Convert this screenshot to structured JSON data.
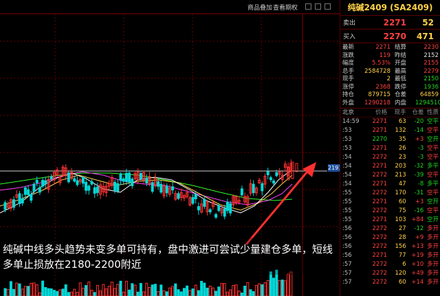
{
  "toolbar": {
    "btn1": "商品叠加",
    "btn2": "查看期权"
  },
  "chart": {
    "price_tag": "2191",
    "caption": "纯碱中线多头趋势未变多单可持有，盘中激进可尝试少量建仓多单，短线多单止损放在2180-2200附近",
    "colors": {
      "up": "#ff3030",
      "down": "#00d8d8",
      "ma5": "#ffffff",
      "ma10": "#ffd24a",
      "ma20": "#ff40ff",
      "ma60": "#30ff30",
      "arrow": "#ff3030"
    }
  },
  "panel": {
    "title": "纯碱2409 (SA2409)",
    "sell": {
      "label": "卖出",
      "price": "2271",
      "vol": "52"
    },
    "buy": {
      "label": "买入",
      "price": "2270",
      "vol": "471"
    },
    "stats": [
      {
        "l1": "最新",
        "v1": "2271",
        "c1": "red",
        "l2": "结算",
        "v2": "2230",
        "c2": "red"
      },
      {
        "l1": "涨跌",
        "v1": "119",
        "c1": "red",
        "l2": "昨结",
        "v2": "2152",
        "c2": "white"
      },
      {
        "l1": "幅度",
        "v1": "5.53%",
        "c1": "red",
        "l2": "开盘",
        "v2": "2155",
        "c2": "red"
      },
      {
        "l1": "总手",
        "v1": "2584728",
        "c1": "yellow",
        "l2": "最高",
        "v2": "2279",
        "c2": "red"
      },
      {
        "l1": "现手",
        "v1": "2",
        "c1": "yellow",
        "l2": "最低",
        "v2": "2150",
        "c2": "green"
      },
      {
        "l1": "涨停",
        "v1": "2368",
        "c1": "red",
        "l2": "跌停",
        "v2": "1936",
        "c2": "green"
      },
      {
        "l1": "持仓",
        "v1": "879715",
        "c1": "yellow",
        "l2": "仓差",
        "v2": "64859",
        "c2": "yellow"
      },
      {
        "l1": "外盘",
        "v1": "1290218",
        "c1": "red",
        "l2": "内盘",
        "v2": "1294510",
        "c2": "green"
      }
    ],
    "ticks_header": {
      "time": "北京",
      "price": "价格",
      "vol": "现手",
      "oi": "仓差",
      "type": "性质"
    },
    "ticks": [
      {
        "t": "14:59",
        "p": "2271",
        "v": "63",
        "oi": "-20",
        "ty": "空平",
        "pc": "red",
        "tc": "green"
      },
      {
        "t": ":53",
        "p": "2271",
        "v": "132",
        "oi": "-14",
        "ty": "空平",
        "pc": "red",
        "tc": "red"
      },
      {
        "t": ":53",
        "p": "2270",
        "v": "35",
        "oi": "+3",
        "ty": "空开",
        "pc": "green",
        "tc": "green"
      },
      {
        "t": ":53",
        "p": "2271",
        "v": "26",
        "oi": "-3",
        "ty": "空平",
        "pc": "red",
        "tc": "red"
      },
      {
        "t": ":54",
        "p": "2272",
        "v": "23",
        "oi": "-3",
        "ty": "空平",
        "pc": "red",
        "tc": "red"
      },
      {
        "t": ":54",
        "p": "2271",
        "v": "203",
        "oi": "-32",
        "ty": "多平",
        "pc": "red",
        "tc": "green"
      },
      {
        "t": ":54",
        "p": "2272",
        "v": "213",
        "oi": "-39",
        "ty": "空平",
        "pc": "red",
        "tc": "red"
      },
      {
        "t": ":54",
        "p": "2271",
        "v": "47",
        "oi": "-8",
        "ty": "多平",
        "pc": "red",
        "tc": "green"
      },
      {
        "t": ":55",
        "p": "2272",
        "v": "170",
        "oi": "-31",
        "ty": "空平",
        "pc": "red",
        "tc": "red"
      },
      {
        "t": ":55",
        "p": "2271",
        "v": "60",
        "oi": "+3",
        "ty": "空开",
        "pc": "red",
        "tc": "green"
      },
      {
        "t": ":55",
        "p": "2272",
        "v": "75",
        "oi": "-16",
        "ty": "空平",
        "pc": "red",
        "tc": "red"
      },
      {
        "t": ":55",
        "p": "2271",
        "v": "103",
        "oi": "+84",
        "ty": "空开",
        "pc": "red",
        "tc": "green"
      },
      {
        "t": ":56",
        "p": "2272",
        "v": "27",
        "oi": "-12",
        "ty": "多开",
        "pc": "red",
        "tc": "red"
      },
      {
        "t": ":56",
        "p": "2272",
        "v": "28",
        "oi": "+9",
        "ty": "多开",
        "pc": "red",
        "tc": "red"
      },
      {
        "t": ":56",
        "p": "2272",
        "v": "156",
        "oi": "+13",
        "ty": "多开",
        "pc": "red",
        "tc": "red"
      },
      {
        "t": ":56",
        "p": "2271",
        "v": "77",
        "oi": "+19",
        "ty": "多开",
        "pc": "red",
        "tc": "red"
      },
      {
        "t": ":57",
        "p": "2272",
        "v": "6",
        "oi": "+10",
        "ty": "多开",
        "pc": "red",
        "tc": "red"
      },
      {
        "t": ":57",
        "p": "2272",
        "v": "120",
        "oi": "+49",
        "ty": "多开",
        "pc": "red",
        "tc": "red"
      },
      {
        "t": ":57",
        "p": "2272",
        "v": "60",
        "oi": "+14",
        "ty": "多开",
        "pc": "red",
        "tc": "red"
      }
    ]
  }
}
